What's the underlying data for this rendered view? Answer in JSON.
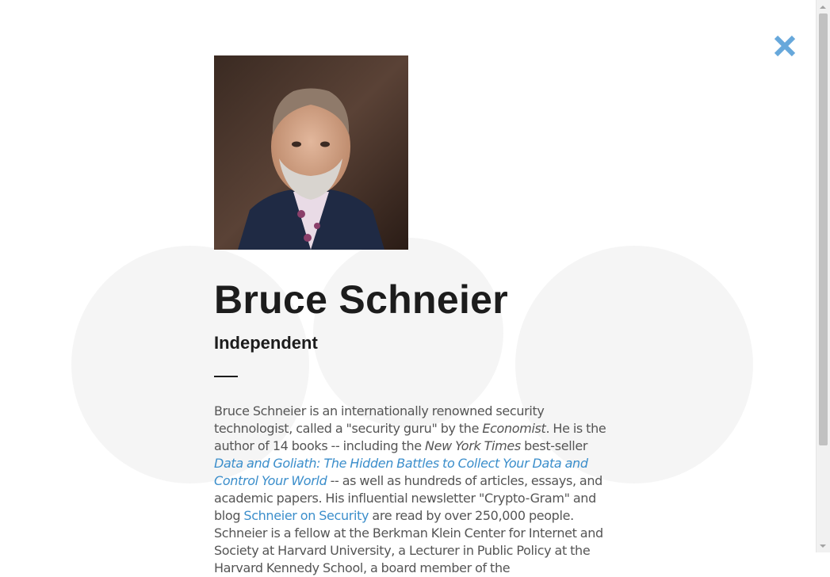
{
  "close": {
    "icon": "close-icon",
    "color": "#67a8db"
  },
  "speaker": {
    "name": "Bruce Schneier",
    "affiliation": "Independent",
    "photo_alt": "Photo of Bruce Schneier"
  },
  "bio": {
    "t1": "Bruce Schneier is an internationally renowned security technologist, called a \"security guru\" by the ",
    "em1": "Economist",
    "t2": ". He is the author of 14 books -- including the ",
    "em2": "New York Times",
    "t3": " best-seller ",
    "link1": "Data and Goliath: The Hidden Battles to Collect Your Data and Control Your World",
    "t4": " -- as well as hundreds of articles, essays, and academic papers. His influential newsletter \"Crypto-Gram\" and blog ",
    "link2": "Schneier on Security",
    "t5": " are read by over 250,000 people. Schneier is a fellow at the Berkman Klein Center for Internet and Society at Harvard University, a Lecturer in Public Policy at the Harvard Kennedy School, a board member of the"
  },
  "colors": {
    "link": "#3b8ecb",
    "text": "#555555",
    "heading": "#1c1c1c"
  }
}
